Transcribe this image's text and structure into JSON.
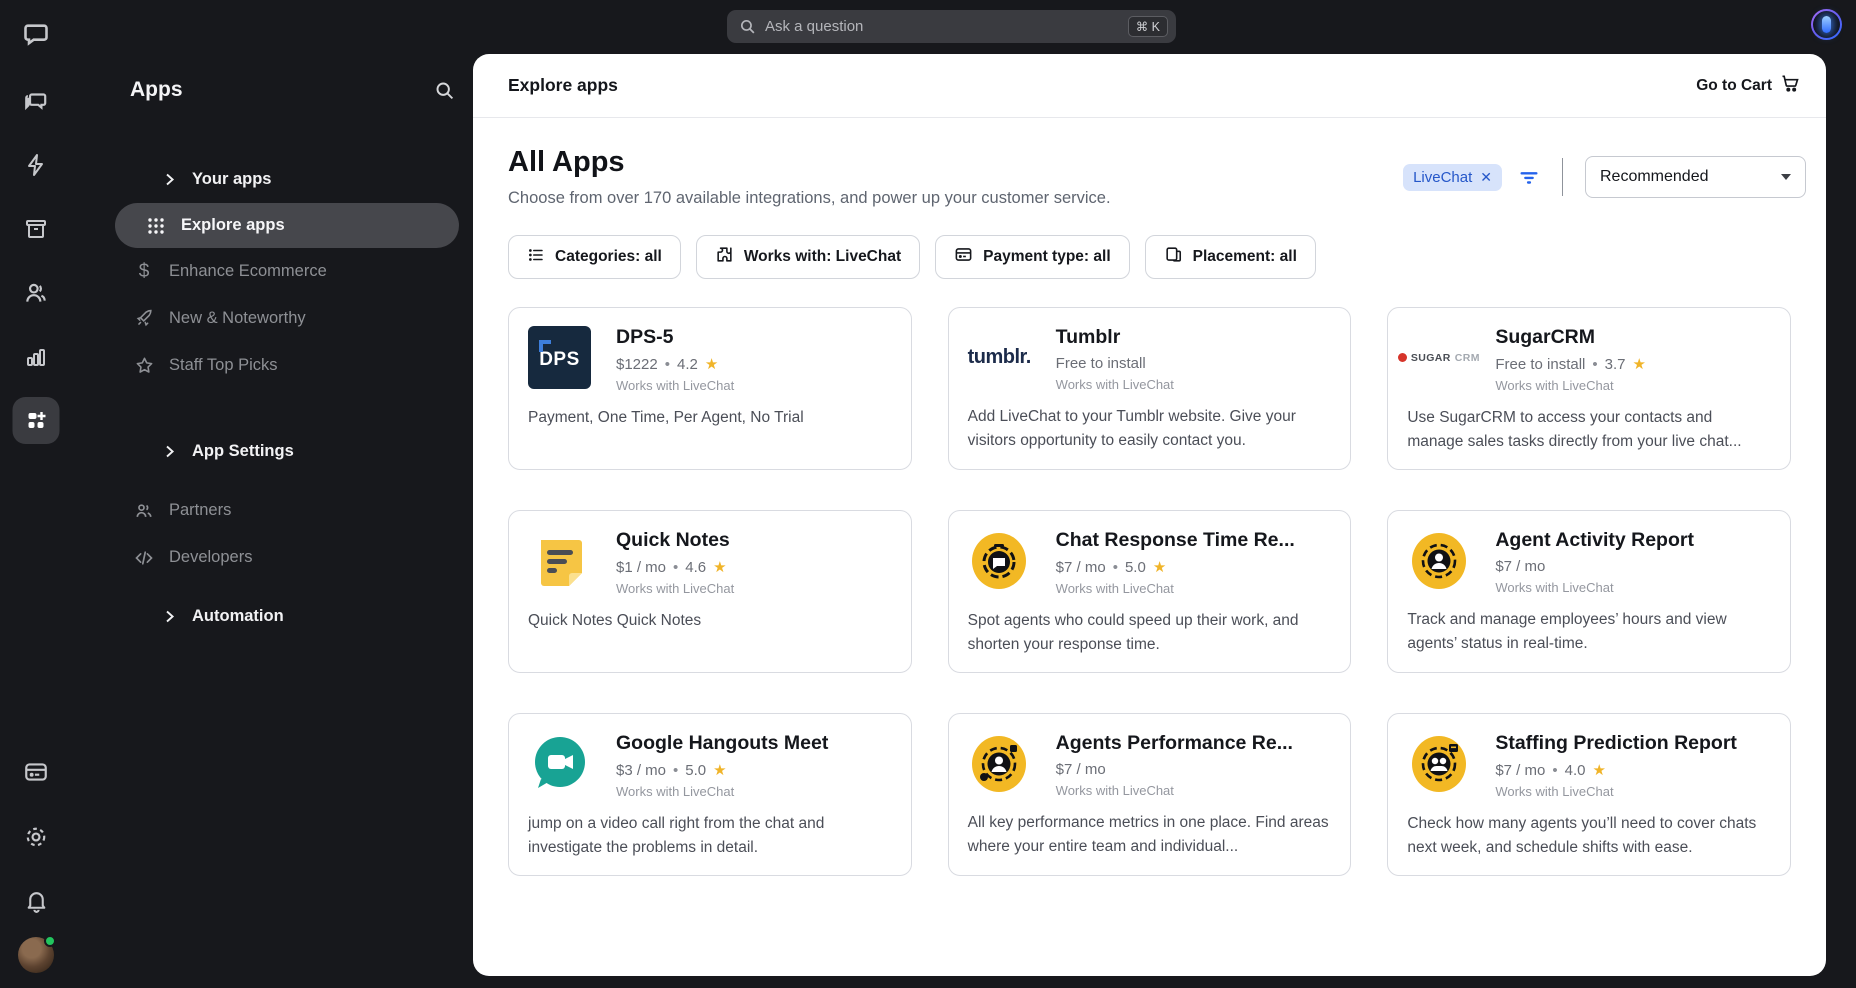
{
  "topbar": {
    "search": {
      "placeholder": "Ask a question",
      "shortcut": "⌘ K"
    }
  },
  "rail": {
    "icons": [
      "livechat-logo",
      "chats",
      "traffic",
      "archive",
      "customers",
      "reports",
      "apps",
      "billing",
      "settings",
      "notifications",
      "avatar"
    ]
  },
  "sidebar": {
    "title": "Apps",
    "items": [
      {
        "label": "Your apps"
      },
      {
        "label": "Explore apps"
      },
      {
        "label": "Enhance Ecommerce"
      },
      {
        "label": "New & Noteworthy"
      },
      {
        "label": "Staff Top Picks"
      },
      {
        "label": "App Settings"
      },
      {
        "label": "Partners"
      },
      {
        "label": "Developers"
      },
      {
        "label": "Automation"
      }
    ]
  },
  "main": {
    "header": {
      "title": "Explore apps",
      "cart_label": "Go to Cart"
    },
    "page_title": "All Apps",
    "subtitle": "Choose from over 170 available integrations, and power up your customer service.",
    "chip_label": "LiveChat",
    "sort_value": "Recommended",
    "works_with": "Works with LiveChat",
    "filters": [
      {
        "label": "Categories: all"
      },
      {
        "label": "Works with: LiveChat"
      },
      {
        "label": "Payment type: all"
      },
      {
        "label": "Placement: all"
      }
    ],
    "cards": [
      {
        "title": "DPS-5",
        "logo_text": "DPS",
        "price": "$1222",
        "rating": "4.2",
        "desc": "Payment, One Time, Per Agent, No Trial"
      },
      {
        "title": "Tumblr",
        "logo_text": "tumblr.",
        "price": "Free to install",
        "desc": "Add LiveChat to your Tumblr website. Give your visitors opportunity to easily contact you."
      },
      {
        "title": "SugarCRM",
        "logo_text": "SUGAR",
        "logo_text2": "CRM",
        "price": "Free to install",
        "rating": "3.7",
        "desc": "Use SugarCRM to access your contacts and manage sales tasks directly from your live chat..."
      },
      {
        "title": "Quick Notes",
        "price": "$1 / mo",
        "rating": "4.6",
        "desc": "Quick Notes Quick Notes"
      },
      {
        "title": "Chat Response Time Re...",
        "price": "$7 / mo",
        "rating": "5.0",
        "desc": "Spot agents who could speed up their work, and shorten your response time."
      },
      {
        "title": "Agent Activity Report",
        "price": "$7 / mo",
        "desc": "Track and manage employees’ hours and view agents’ status in real-time."
      },
      {
        "title": "Google Hangouts Meet",
        "price": "$3 / mo",
        "rating": "5.0",
        "desc": "jump on a video call right from the chat and investigate the problems in detail."
      },
      {
        "title": "Agents Performance Re...",
        "price": "$7 / mo",
        "desc": "All key performance metrics in one place. Find areas where your entire team and individual..."
      },
      {
        "title": "Staffing Prediction Report",
        "price": "$7 / mo",
        "rating": "4.0",
        "desc": "Check how many agents you’ll need to cover chats next week, and schedule shifts with ease."
      }
    ]
  },
  "colors": {
    "dark_bg": "#17181c",
    "panel_bg": "#ffffff",
    "accent_blue": "#2563eb",
    "chip_bg": "#d7e3fb",
    "chip_text": "#2557c9",
    "star_gold": "#f0b429",
    "active_pill": "#46474c",
    "dps_navy": "#16293e",
    "report_yellow": "#f2b824",
    "meet_teal": "#18a394",
    "online_green": "#22c55e"
  }
}
